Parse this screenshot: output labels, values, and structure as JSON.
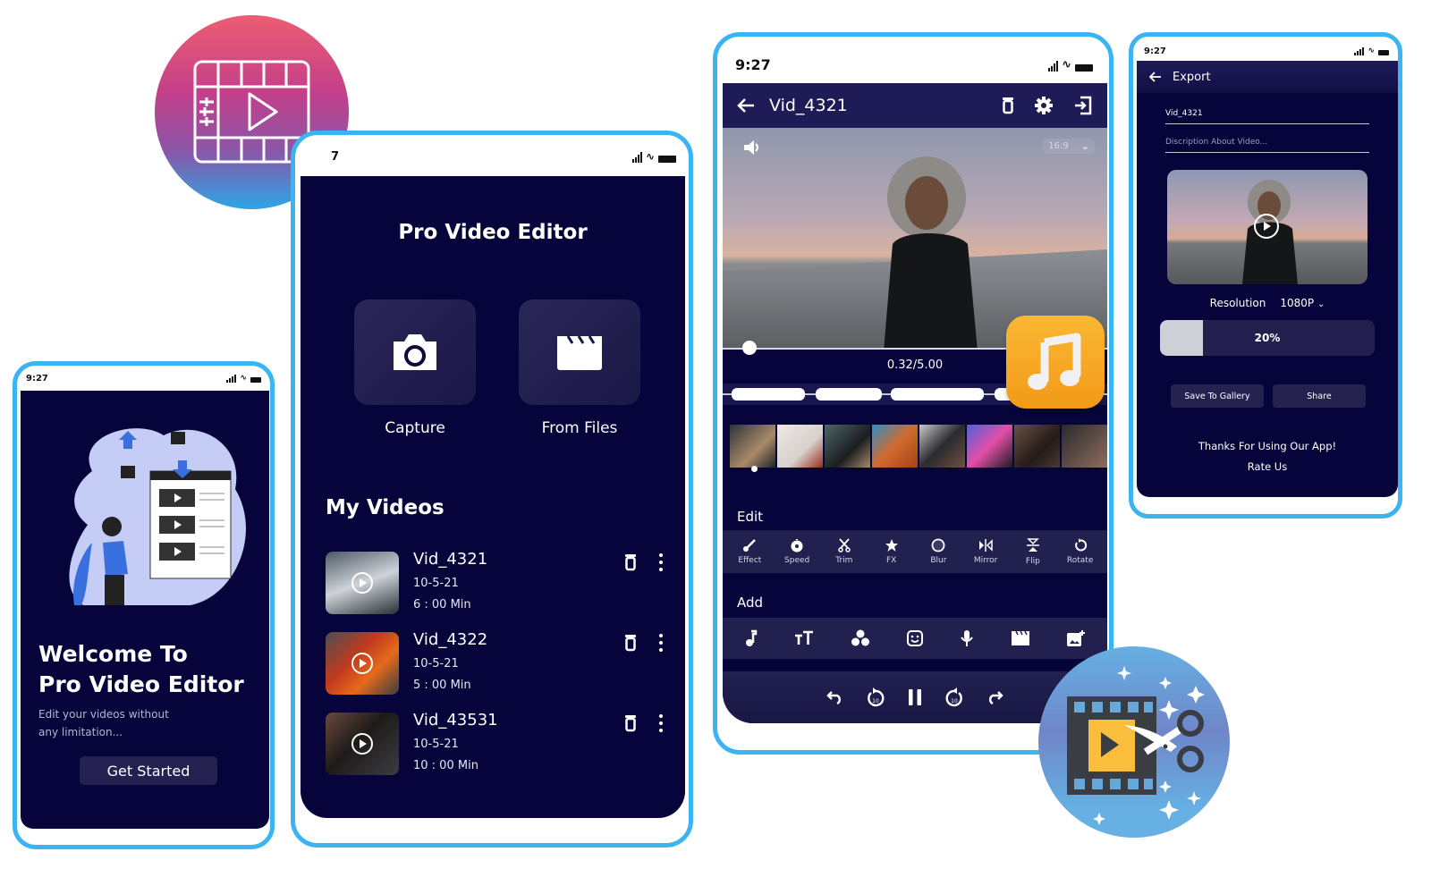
{
  "colors": {
    "frame": "#3ab4f2",
    "screen_bg": "#06043a",
    "toolbar_bg": "#1f1b56",
    "accent_orange": "#f6a823"
  },
  "welcome_screen": {
    "status_time": "9:27",
    "title_line1": "Welcome To",
    "title_line2": "Pro Video Editor",
    "subtitle_line1": "Edit your videos without",
    "subtitle_line2": "any limitation...",
    "button": "Get Started"
  },
  "home_screen": {
    "status_time": "7",
    "app_title": "Pro Video Editor",
    "actions": [
      {
        "label": "Capture",
        "icon": "camera-icon"
      },
      {
        "label": "From Files",
        "icon": "clapperboard-icon"
      }
    ],
    "section_title": "My Videos",
    "videos": [
      {
        "name": "Vid_4321",
        "date": "10-5-21",
        "duration": "6 : 00 Min"
      },
      {
        "name": "Vid_4322",
        "date": "10-5-21",
        "duration": "5 : 00 Min"
      },
      {
        "name": "Vid_43531",
        "date": "10-5-21",
        "duration": "10 : 00 Min"
      }
    ]
  },
  "editor_screen": {
    "status_time": "9:27",
    "title": "Vid_4321",
    "aspect_ratio": "16:9",
    "timecode": "0.32/5.00",
    "playback_progress": 0.07,
    "edit_section": "Edit",
    "edit_tools": [
      {
        "label": "Effect",
        "icon": "brush-icon"
      },
      {
        "label": "Speed",
        "icon": "speedometer-icon"
      },
      {
        "label": "Trim",
        "icon": "scissors-icon"
      },
      {
        "label": "FX",
        "icon": "star-icon"
      },
      {
        "label": "Blur",
        "icon": "circle-icon"
      },
      {
        "label": "Mirror",
        "icon": "mirror-icon"
      },
      {
        "label": "Flip",
        "icon": "flip-icon"
      },
      {
        "label": "Rotate",
        "icon": "rotate-icon"
      }
    ],
    "add_section": "Add",
    "add_tools": [
      "music-note-icon",
      "text-size-icon",
      "color-filter-icon",
      "sticker-icon",
      "microphone-icon",
      "clapperboard-icon",
      "add-image-icon"
    ],
    "playback_controls": [
      "undo-icon",
      "rewind-10-icon",
      "pause-icon",
      "forward-10-icon",
      "redo-icon"
    ]
  },
  "export_screen": {
    "status_time": "9:27",
    "title": "Export",
    "name_value": "Vid_4321",
    "description_placeholder": "Discription About Video...",
    "resolution_label": "Resolution",
    "resolution_value": "1080P",
    "progress_percent": 20,
    "progress_label": "20%",
    "save_button": "Save To Gallery",
    "share_button": "Share",
    "thanks_text": "Thanks For Using Our App!",
    "rate_text": "Rate Us"
  }
}
